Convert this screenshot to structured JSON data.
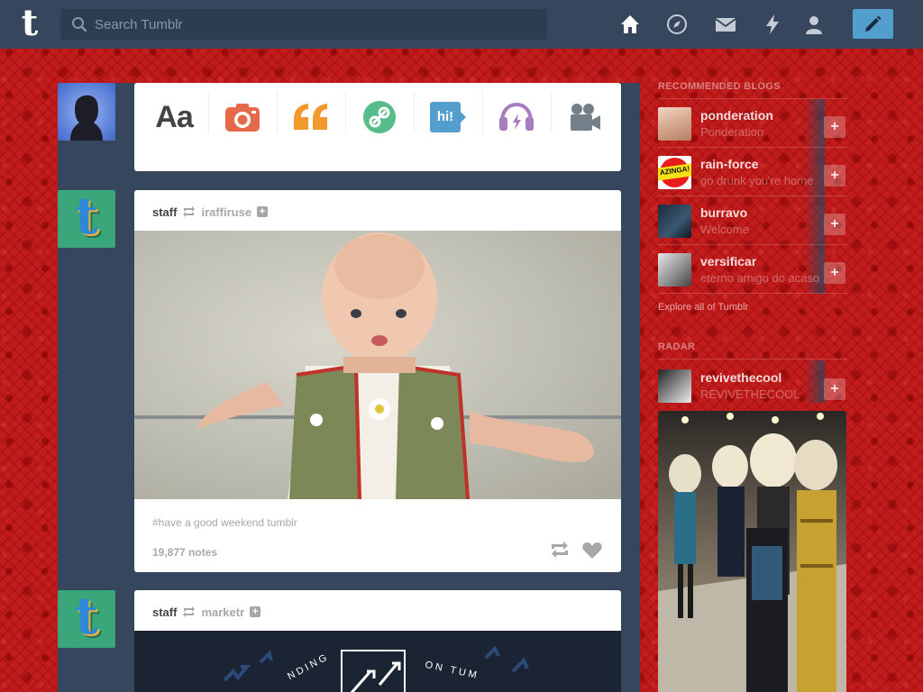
{
  "header": {
    "logo_letter": "t",
    "search_placeholder": "Search Tumblr",
    "nav_icons": [
      "home-icon",
      "explore-icon",
      "mail-icon",
      "lightning-icon",
      "account-icon"
    ],
    "compose_icon": "pencil-icon",
    "brand_color": "#36465d",
    "accent_color": "#529ecc"
  },
  "post_types": {
    "text_label": "Aa",
    "chat_label": "hi!",
    "icons": [
      "text-icon",
      "photo-icon",
      "quote-icon",
      "link-icon",
      "chat-icon",
      "audio-icon",
      "video-icon"
    ]
  },
  "posts": [
    {
      "author": "staff",
      "reblogged_from": "iraffiruse",
      "tags": "#have a good weekend tumblr",
      "notes": "19,877 notes"
    },
    {
      "author": "staff",
      "reblogged_from": "marketr",
      "banner_text_left": "NDING",
      "banner_text_right": "ON TUM"
    }
  ],
  "sidebar": {
    "recommended_heading": "RECOMMENDED BLOGS",
    "blogs": [
      {
        "name": "ponderation",
        "title": "Ponderation"
      },
      {
        "name": "rain-force",
        "title": "go drunk you're home"
      },
      {
        "name": "burravo",
        "title": "Welcome"
      },
      {
        "name": "versificar",
        "title": "eterno amigo do acaso"
      }
    ],
    "badge_text": "AZINGA!",
    "explore_link": "Explore all of Tumblr",
    "radar_heading": "RADAR",
    "radar_blog": {
      "name": "revivethecool",
      "title": "REVIVETHECOOL"
    },
    "follow_symbol": "+"
  }
}
